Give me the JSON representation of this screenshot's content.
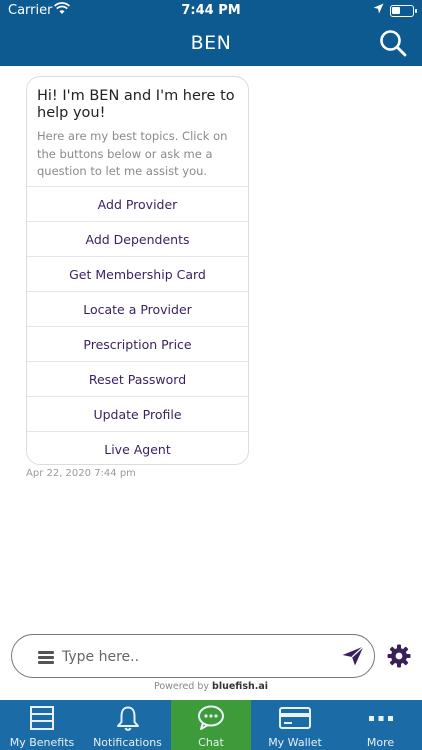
{
  "status_bar": {
    "carrier": "Carrier",
    "time": "7:44 PM"
  },
  "header": {
    "title": "BEN"
  },
  "chat": {
    "greeting": "Hi! I'm BEN and I'm here to help you!",
    "subtext": "Here are my best topics. Click on the buttons below or ask me a question to let me assist you.",
    "options": [
      "Add Provider",
      "Add Dependents",
      "Get Membership Card",
      "Locate a Provider",
      "Prescription Price",
      "Reset Password",
      "Update Profile",
      "Live Agent"
    ],
    "timestamp": "Apr 22, 2020 7:44 pm"
  },
  "composer": {
    "placeholder": "Type here.."
  },
  "powered": {
    "prefix": "Powered by",
    "brand": "bluefish.ai"
  },
  "tabs": [
    {
      "label": "My Benefits",
      "icon": "benefits-icon"
    },
    {
      "label": "Notifications",
      "icon": "bell-icon"
    },
    {
      "label": "Chat",
      "icon": "chat-icon",
      "active": true
    },
    {
      "label": "My Wallet",
      "icon": "wallet-icon"
    },
    {
      "label": "More",
      "icon": "more-dots-icon"
    }
  ],
  "colors": {
    "header": "#0c5a8f",
    "tabbar": "#1b6ba6",
    "active_tab": "#3d9b3a",
    "option_text": "#3a1f5e",
    "send_icon": "#3a1f5e"
  }
}
